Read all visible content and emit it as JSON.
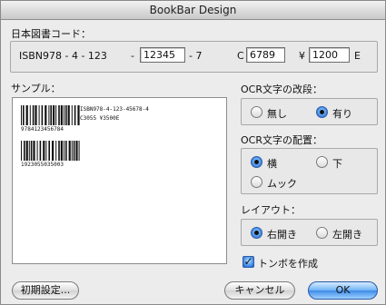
{
  "window": {
    "title": "BookBar Design"
  },
  "code_section": {
    "label": "日本図書コード：",
    "isbn_prefix": "ISBN978 - 4 -  123",
    "dash1": "-",
    "isbn_field_value": "12345",
    "check_suffix": "- 7",
    "c_label": "C",
    "c_field_value": "6789",
    "yen_label": "¥",
    "price_field_value": "1200",
    "e_label": "E"
  },
  "sample": {
    "label": "サンプル：",
    "barcode1_digits": "9784123456784",
    "barcode2_digits": "1923055035003",
    "ocr_line1": "ISBN978-4-123-45678-4",
    "ocr_line2": "C3055 ¥3500E"
  },
  "ocr_break": {
    "label": "OCR文字の改段：",
    "options": [
      "無し",
      "有り"
    ],
    "selected": "有り"
  },
  "ocr_placement": {
    "label": "OCR文字の配置：",
    "options": [
      "横",
      "下",
      "ムック"
    ],
    "selected": "横"
  },
  "layout": {
    "label": "レイアウト：",
    "options": [
      "右開き",
      "左開き"
    ],
    "selected": "右開き"
  },
  "crop_marks": {
    "label": "トンボを作成",
    "checked": true
  },
  "buttons": {
    "defaults": "初期設定...",
    "cancel": "キャンセル",
    "ok": "OK"
  },
  "colors": {
    "accent": "#3e8ce8",
    "window_bg": "#ececec"
  }
}
